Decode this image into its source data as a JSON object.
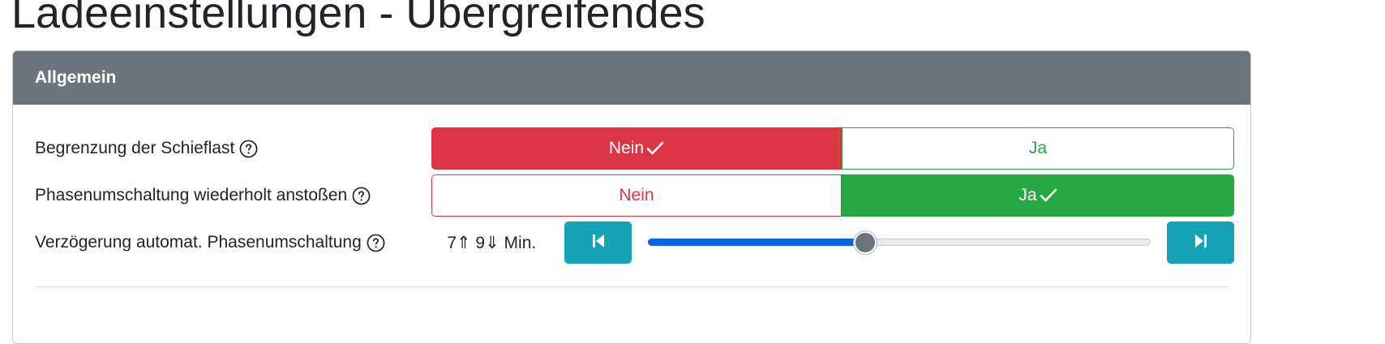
{
  "page": {
    "title": "Ladeeinstellungen - Übergreifendes"
  },
  "card": {
    "header": "Allgemein"
  },
  "settings": {
    "schieflast": {
      "label": "Begrenzung der Schieflast",
      "help_icon": "question-circle-icon",
      "options": {
        "no": "Nein",
        "yes": "Ja"
      },
      "selected": "no"
    },
    "phasenumschaltung": {
      "label": "Phasenumschaltung wiederholt anstoßen",
      "help_icon": "question-circle-icon",
      "options": {
        "no": "Nein",
        "yes": "Ja"
      },
      "selected": "yes"
    },
    "verzoegerung": {
      "label": "Verzögerung automat. Phasenumschaltung",
      "help_icon": "question-circle-icon",
      "value_text": "7⇑ 9⇓ Min.",
      "decrement_icon": "skip-backward-icon",
      "increment_icon": "skip-forward-icon",
      "slider_fraction": 0.432
    }
  },
  "colors": {
    "danger": "#dc3545",
    "success": "#28a745",
    "info": "#17a2b8",
    "header": "#6c757d",
    "slider_fill": "#0b63e5"
  }
}
